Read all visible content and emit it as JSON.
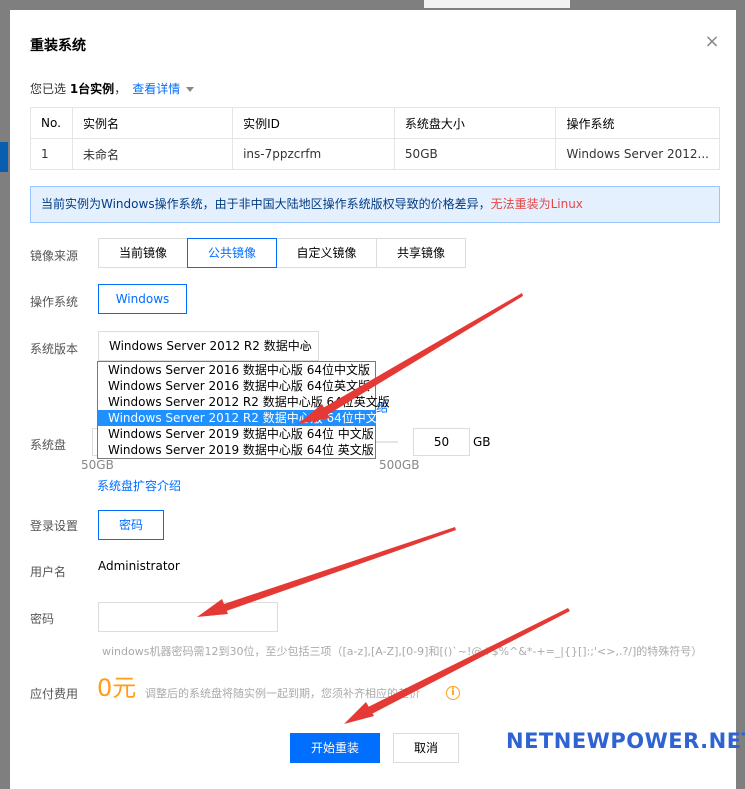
{
  "dialog": {
    "title": "重装系统",
    "close_icon": "close-icon"
  },
  "selection": {
    "prefix": "您已选 ",
    "count_text": "1台实例",
    "suffix": "，",
    "detail_link": "查看详情"
  },
  "instance_table": {
    "headers": [
      "No.",
      "实例名",
      "实例ID",
      "系统盘大小",
      "操作系统"
    ],
    "rows": [
      [
        "1",
        "未命名",
        "ins-7ppzcrfm",
        "50GB",
        "Windows Server 2012..."
      ]
    ]
  },
  "notice": {
    "text": "当前实例为Windows操作系统，由于非中国大陆地区操作系统版权导致的价格差异，",
    "warning": "无法重装为Linux"
  },
  "form": {
    "image_source_label": "镜像来源",
    "image_source_options": [
      "当前镜像",
      "公共镜像",
      "自定义镜像",
      "共享镜像"
    ],
    "image_source_selected": "公共镜像",
    "os_label": "操作系统",
    "os_value": "Windows",
    "version_label": "系统版本",
    "version_value": "Windows Server 2012 R2 数据中心",
    "version_options": [
      "Windows Server 2016 数据中心版 64位中文版",
      "Windows Server 2016 数据中心版 64位英文版",
      "Windows Server 2012 R2 数据中心版 64位英文版",
      "Windows Server 2012 R2 数据中心版 64位中文版",
      "Windows Server 2019 数据中心版 64位 中文版",
      "Windows Server 2019 数据中心版 64位 英文版"
    ],
    "version_highlighted_index": 3,
    "partial_link_char": "绍",
    "disk_label": "系统盘",
    "disk_value": "50",
    "disk_unit": "GB",
    "disk_min": "50GB",
    "disk_max": "500GB",
    "disk_expand_link": "系统盘扩容介绍",
    "login_label": "登录设置",
    "login_value": "密码",
    "username_label": "用户名",
    "username_value": "Administrator",
    "password_label": "密码",
    "password_value": "",
    "password_hint": "windows机器密码需12到30位，至少包括三项（[a-z],[A-Z],[0-9]和[()`~!@#$%^&*-+=_|{}[]:;'<>,.?/]的特殊符号）",
    "fee_label": "应付费用",
    "fee_value": "0元",
    "fee_note": "调整后的系统盘将随实例一起到期，您须补齐相应的差价"
  },
  "actions": {
    "confirm": "开始重装",
    "cancel": "取消"
  },
  "watermark": "NETNEWPOWER.NET",
  "colors": {
    "accent": "#006eff",
    "warning": "#e54545",
    "price": "#ff9c19",
    "arrow": "#e53935",
    "watermark": "#2f63d4"
  }
}
